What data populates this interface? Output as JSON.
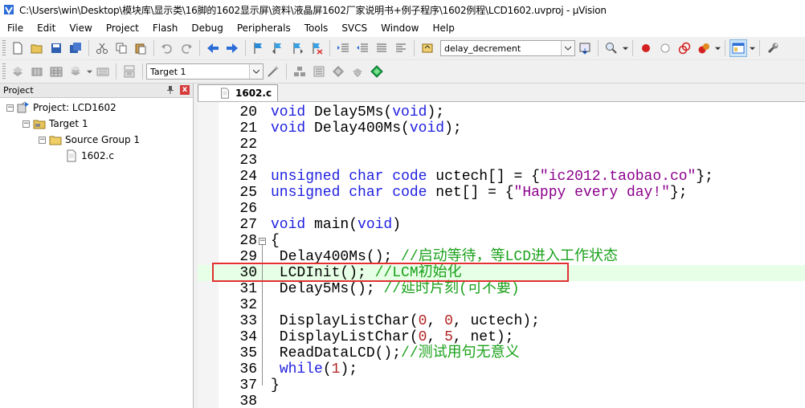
{
  "window": {
    "title": "C:\\Users\\win\\Desktop\\模块库\\显示类\\16脚的1602显示屏\\资料\\液晶屏1602厂家说明书+例子程序\\1602例程\\LCD1602.uvproj - µVision"
  },
  "menu": {
    "items": [
      "File",
      "Edit",
      "View",
      "Project",
      "Flash",
      "Debug",
      "Peripherals",
      "Tools",
      "SVCS",
      "Window",
      "Help"
    ]
  },
  "toolbar": {
    "find_combo_value": "delay_decrement",
    "target_combo_value": "Target 1"
  },
  "project_pane": {
    "title": "Project",
    "close_label": "x",
    "tree": {
      "project": "Project: LCD1602",
      "target": "Target 1",
      "group": "Source Group 1",
      "file": "1602.c"
    }
  },
  "editor": {
    "tab_label": "1602.c",
    "lines": [
      {
        "num": "20",
        "code": "void Delay5Ms(void);"
      },
      {
        "num": "21",
        "code": "void Delay400Ms(void);"
      },
      {
        "num": "22",
        "code": ""
      },
      {
        "num": "23",
        "code": ""
      },
      {
        "num": "24",
        "code": "unsigned char code uctech[] = {\"ic2012.taobao.co\"};"
      },
      {
        "num": "25",
        "code": "unsigned char code net[] = {\"Happy every day!\"};"
      },
      {
        "num": "26",
        "code": ""
      },
      {
        "num": "27",
        "code": "void main(void)"
      },
      {
        "num": "28",
        "code": "{"
      },
      {
        "num": "29",
        "code": " Delay400Ms(); //启动等待，等LCD进入工作状态"
      },
      {
        "num": "30",
        "code": " LCDInit(); //LCM初始化"
      },
      {
        "num": "31",
        "code": " Delay5Ms(); //延时片刻(可不要)"
      },
      {
        "num": "32",
        "code": ""
      },
      {
        "num": "33",
        "code": " DisplayListChar(0, 0, uctech);"
      },
      {
        "num": "34",
        "code": " DisplayListChar(0, 5, net);"
      },
      {
        "num": "35",
        "code": " ReadDataLCD();//测试用句无意义"
      },
      {
        "num": "36",
        "code": " while(1);"
      },
      {
        "num": "37",
        "code": "}"
      },
      {
        "num": "38",
        "code": ""
      }
    ],
    "highlighted_line": "30"
  },
  "colors": {
    "keyword": "#1f1fe0",
    "string": "#8b008b",
    "number": "#b22222",
    "comment": "#1aa11a",
    "current_line": "#e6ffe6",
    "annotation_box": "#e23030"
  }
}
